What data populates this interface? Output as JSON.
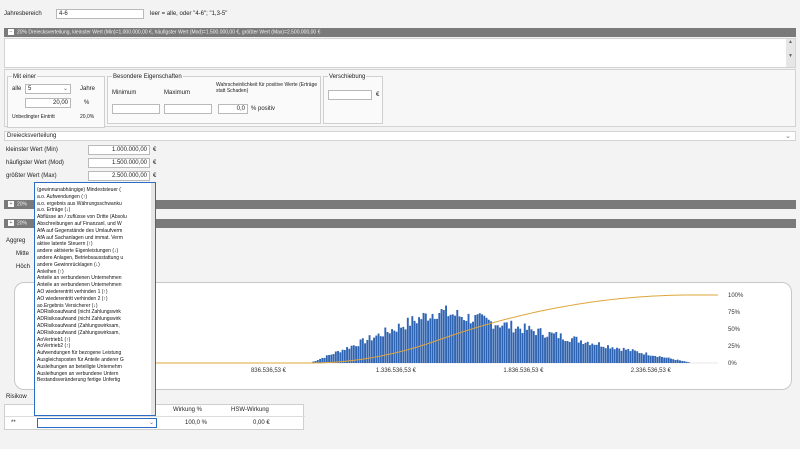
{
  "year_range": {
    "label": "Jahresbereich",
    "value": "4-6",
    "hint": "leer = alle, oder \"4-6\"; \"1,3-5\""
  },
  "section_header": "20% Dreiecksverteilung, kleinster Wert (Min)=1.000.000,00 €, häufigster Wert (Mod)=1.500.000,00 €, größter Wert (Max)=2.500.000,00 €",
  "occurrence": {
    "title": "Mit einer",
    "prefix": "alle",
    "every_value": "5",
    "every_unit": "Jahre",
    "percent_value": "20,00",
    "percent_unit": "%",
    "unconditional_label": "Unbedingter Eintritt",
    "unconditional_value": "20,0%"
  },
  "special": {
    "title": "Besondere Eigenschaften",
    "min_label": "Minimum",
    "max_label": "Maximum",
    "prob_label": "Wahrscheinlichkeit für positive Werte (Erträge statt Schaden)",
    "prob_value": "0,0",
    "prob_unit": "% positiv"
  },
  "shift": {
    "title": "Verschiebung",
    "unit": "€"
  },
  "distribution": {
    "label": "Dreiecksverteilung",
    "min_label": "kleinster Wert (Min)",
    "min_value": "1.000.000,00",
    "mod_label": "häufigster Wert (Mod)",
    "mod_value": "1.500.000,00",
    "max_label": "größter Wert (Max)",
    "max_value": "2.500.000,00",
    "currency": "€"
  },
  "collapsed_headers": [
    "20%",
    "20%"
  ],
  "side_labels": {
    "aggregation": "Aggreg",
    "mittel": "Mitte",
    "hoch": "Höch",
    "risikowirkung": "Risikow"
  },
  "dropdown": {
    "items": [
      "(gewinnunabhängige) Mindeststeuer (",
      "a.o. Aufwendungen (↑)",
      "a.o. ergebnis aus Währungsschwanku",
      "a.o. Erträge (↓)",
      "Abflüsse an / zuflüsse von Dritte (Absolu",
      "Abschreibungen auf Finanzanl. und W",
      "AfA auf Gegenstände des Umlaufverm",
      "AfA auf Sachanlagen und immat. Verm",
      "aktive latente Steuern (↑)",
      "andere aktivierte Eigenleistungen (↓)",
      "andere Anlagen, Betriebsausstattung u",
      "andere Gewinnrücklagen (↓)",
      "Anleihen (↑)",
      "Anteile an verbundenen Unternehmen",
      "Anteile an verbundenen Unternehmen",
      "AO wiederentritt verhinden 1 (↑)",
      "AO wiederentritt verhinden 2 (↑)",
      "ao.Ergebnis Versicherer (↓)",
      "ADRisikoaufwand (nicht Zahlungswirk",
      "ADRisikoaufwand (nicht Zahlungswirk",
      "ADRisikoaufwand (Zahlungswirksam,",
      "ADRisikoaufwand (Zahlungswirksam,",
      "AoVertrieb1 (↑)",
      "AoVertrieb2 (↑)",
      "Aufwendungen für bezogene Leistung",
      "Ausgleichsposten für Anteile anderer G",
      "Ausleihungen an beteiligte Unternehm",
      "Ausleihungen an verbundene Untern",
      "Bestandsveränderung fertige Unfertig"
    ]
  },
  "table": {
    "col_wirkung": "Wirkung %",
    "col_hsw": "HSW-Wirkung",
    "row_marker": "**",
    "row_wirkung": "100,0 %",
    "row_hsw": "0,00 €"
  },
  "chart_data": {
    "type": "bar",
    "x_tick_labels": [
      "836.536,53 €",
      "1.336.536,53 €",
      "1.836.536,53 €",
      "2.336.536,53 €"
    ],
    "y2_tick_labels": [
      "100%",
      "75%",
      "50%",
      "25%",
      "0%"
    ],
    "x_range": [
      336536.53,
      2600000
    ],
    "distribution_shape": "triangular",
    "min": 1000000,
    "mode": "1500000",
    "max": 2500000,
    "bar_color": "#2f64b3",
    "cumulative_line_color": "#e0a53a"
  },
  "colors": {
    "header_bg": "#7a7a7a",
    "selection_border": "#2b6cc4"
  }
}
